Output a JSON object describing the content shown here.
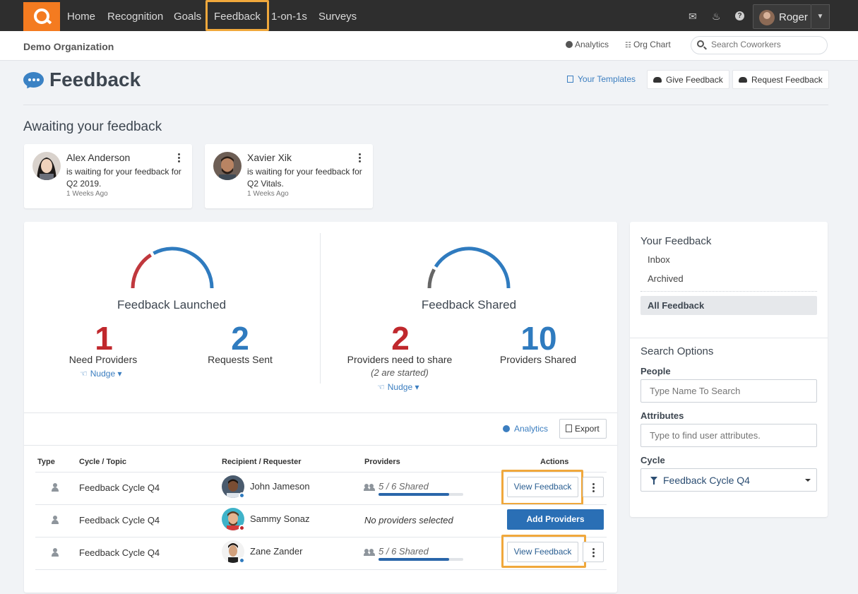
{
  "nav": {
    "items": [
      "Home",
      "Recognition",
      "Goals",
      "Feedback",
      "1-on-1s",
      "Surveys"
    ],
    "user_name": "Roger"
  },
  "subbar": {
    "org": "Demo Organization",
    "analytics": "Analytics",
    "org_chart": "Org Chart",
    "search_placeholder": "Search Coworkers"
  },
  "header": {
    "title": "Feedback",
    "templates": "Your Templates",
    "give": "Give Feedback",
    "request": "Request Feedback"
  },
  "awaiting": {
    "title": "Awaiting your feedback",
    "cards": [
      {
        "name": "Alex Anderson",
        "message": "is waiting for your feedback for Q2 2019.",
        "time": "1 Weeks Ago"
      },
      {
        "name": "Xavier Xik",
        "message": "is waiting for your feedback for Q2 Vitals.",
        "time": "1 Weeks Ago"
      }
    ]
  },
  "stats": {
    "launched": {
      "title": "Feedback Launched",
      "need_providers": "1",
      "need_providers_label": "Need Providers",
      "requests_sent": "2",
      "requests_sent_label": "Requests Sent",
      "nudge": "Nudge",
      "gauge_red_fraction": 0.33
    },
    "shared": {
      "title": "Feedback Shared",
      "need_share": "2",
      "need_share_label": "Providers need to share",
      "need_share_sub": "(2 are started)",
      "shared": "10",
      "shared_label": "Providers Shared",
      "nudge": "Nudge",
      "gauge_red_fraction": 0.17
    }
  },
  "toolbar": {
    "analytics": "Analytics",
    "export": "Export"
  },
  "table": {
    "headers": [
      "Type",
      "Cycle / Topic",
      "Recipient / Requester",
      "Providers",
      "Actions"
    ],
    "rows": [
      {
        "cycle": "Feedback Cycle Q4",
        "recipient": "John Jameson",
        "providers": "5 / 6 Shared",
        "progress": 0.83,
        "action": "View Feedback"
      },
      {
        "cycle": "Feedback Cycle Q4",
        "recipient": "Sammy Sonaz",
        "providers": "No providers selected",
        "action": "Add Providers"
      },
      {
        "cycle": "Feedback Cycle Q4",
        "recipient": "Zane Zander",
        "providers": "5 / 6 Shared",
        "progress": 0.83,
        "action": "View Feedback"
      }
    ]
  },
  "sidebar": {
    "your_feedback": "Your Feedback",
    "inbox": "Inbox",
    "archived": "Archived",
    "all": "All Feedback",
    "search_options": "Search Options",
    "people_label": "People",
    "people_placeholder": "Type Name To Search",
    "attributes_label": "Attributes",
    "attributes_placeholder": "Type to find user attributes.",
    "cycle_label": "Cycle",
    "cycle_value": "Feedback Cycle Q4"
  },
  "colors": {
    "red": "#c0282d",
    "blue": "#2f7bbf",
    "accent": "#f0a83c",
    "brand": "#f47b20"
  }
}
